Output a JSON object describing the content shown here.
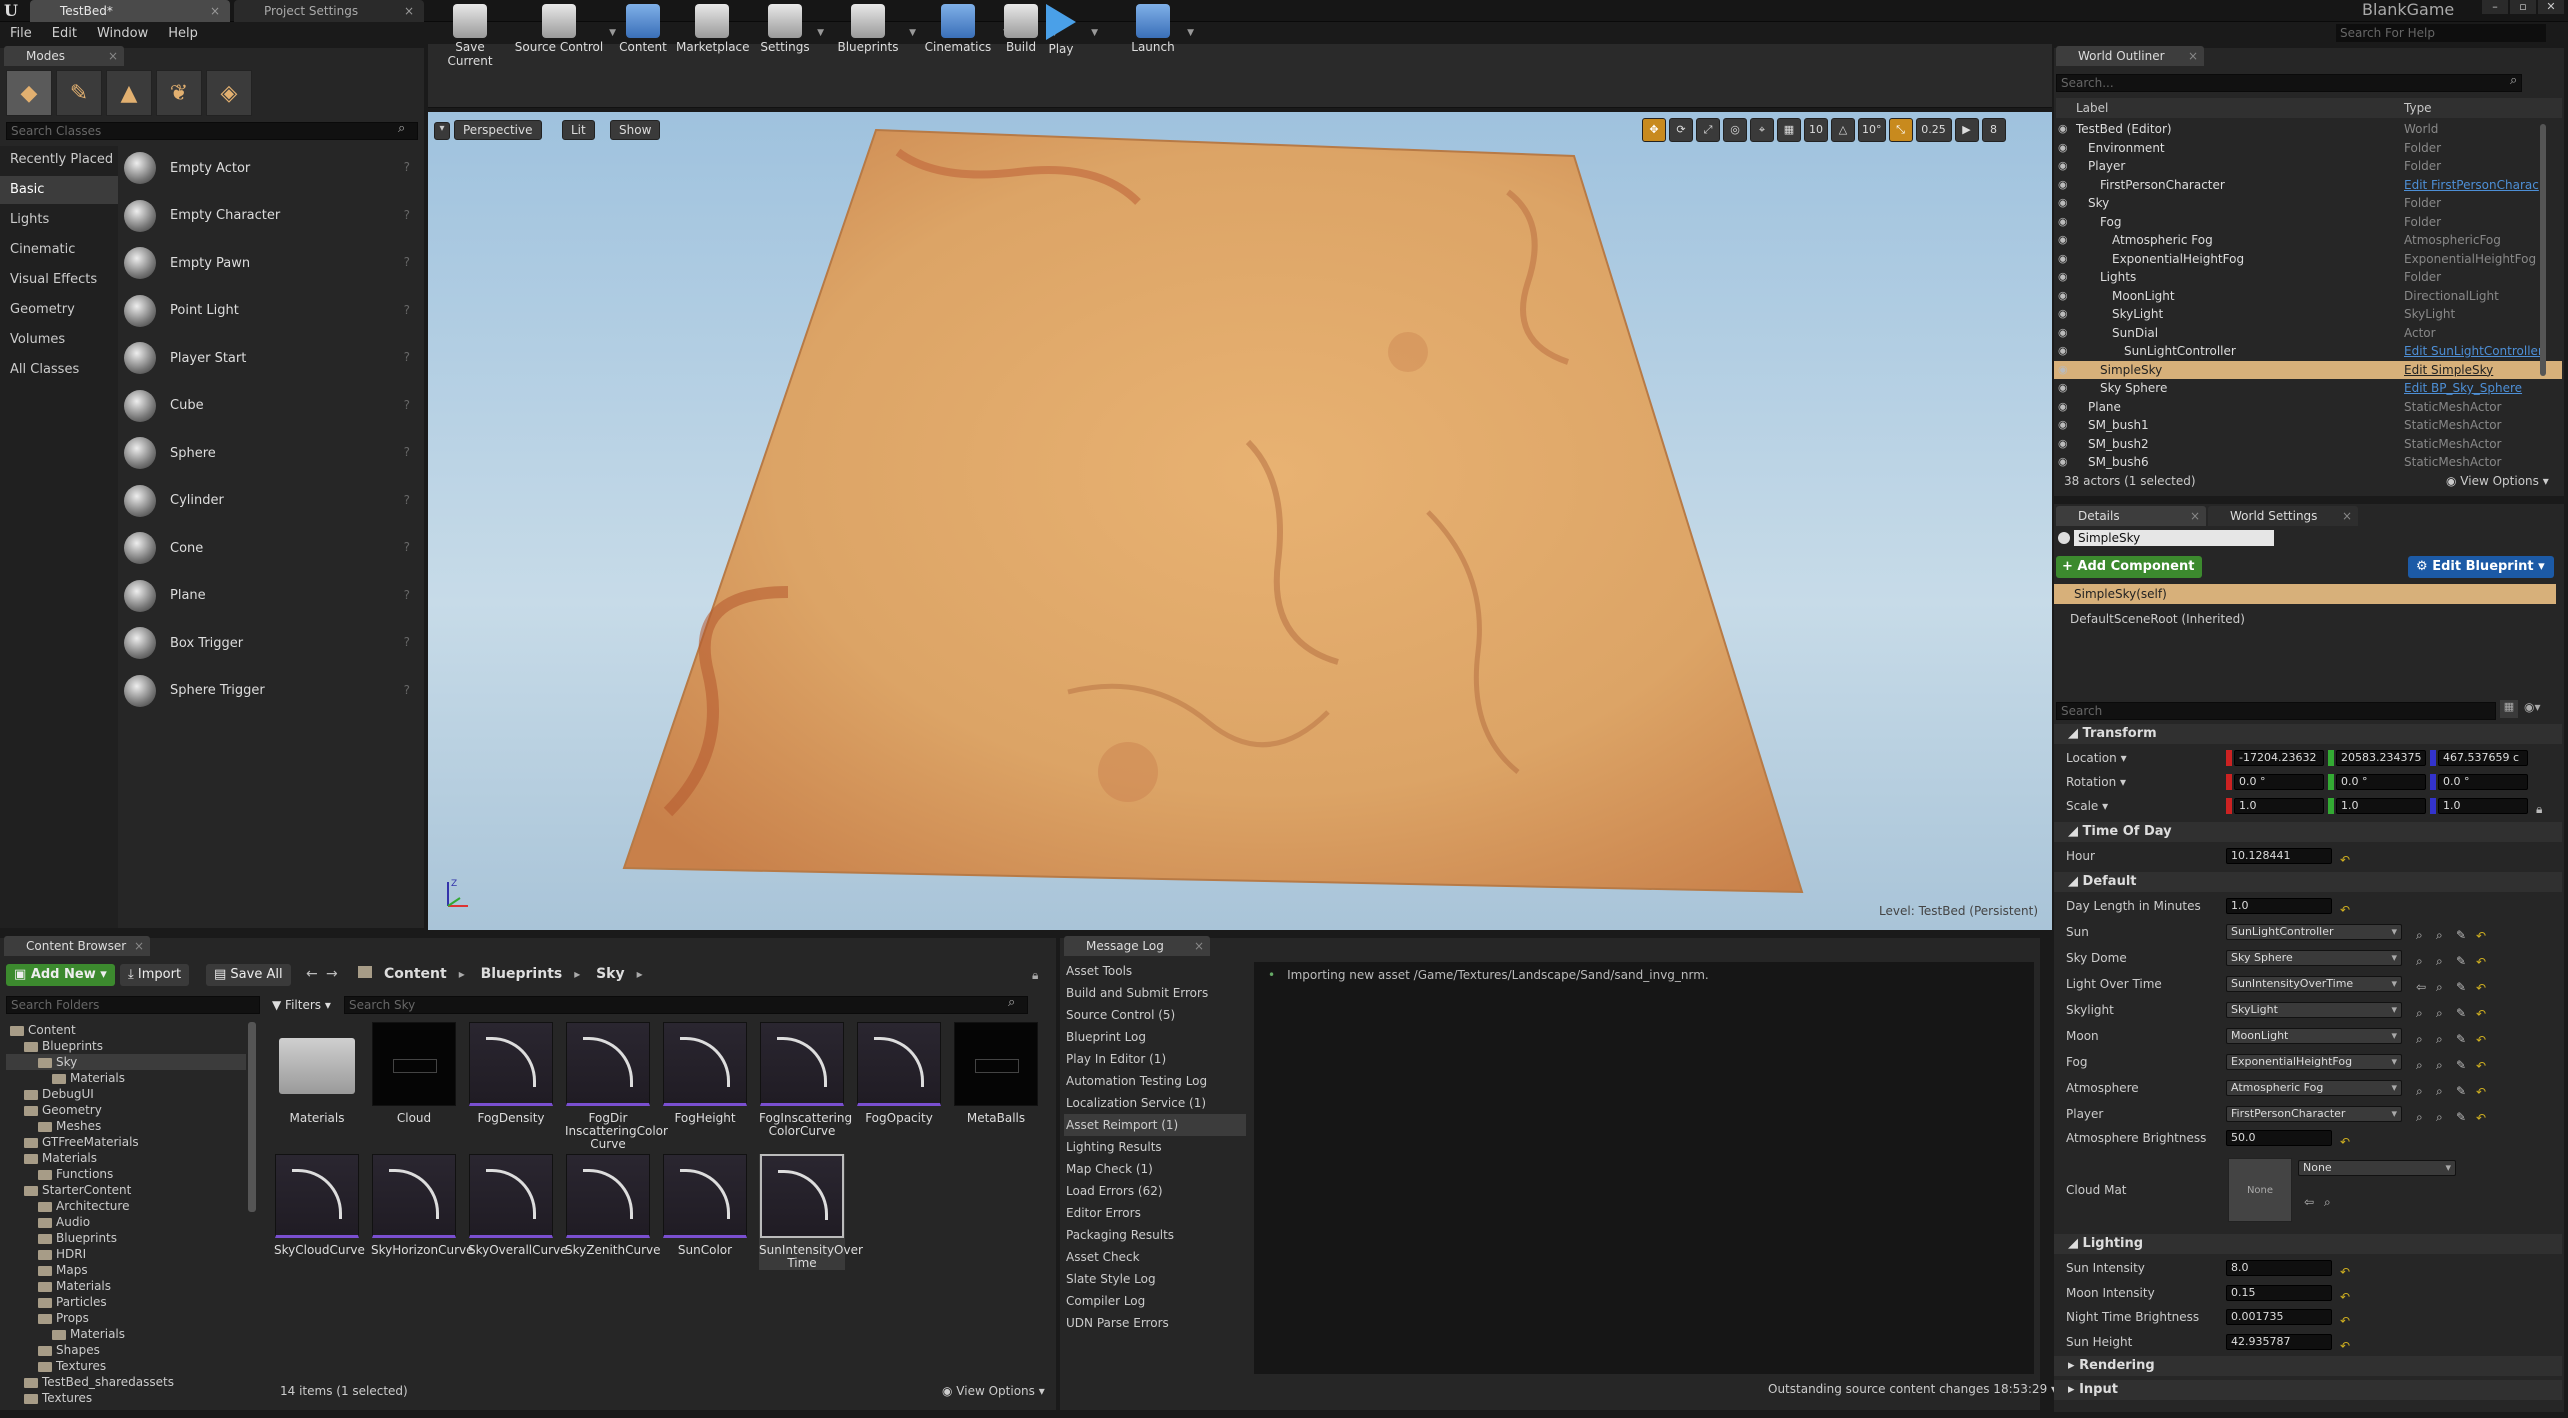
{
  "window": {
    "tabs": [
      "TestBed*",
      "Project Settings"
    ],
    "game_name": "BlankGame",
    "help_search_placeholder": "Search For Help",
    "menu": [
      "File",
      "Edit",
      "Window",
      "Help"
    ]
  },
  "modes": {
    "tab": "Modes",
    "search_placeholder": "Search Classes",
    "categories": [
      "Recently Placed",
      "Basic",
      "Lights",
      "Cinematic",
      "Visual Effects",
      "Geometry",
      "Volumes",
      "All Classes"
    ],
    "selected_category": "Basic",
    "items": [
      "Empty Actor",
      "Empty Character",
      "Empty Pawn",
      "Point Light",
      "Player Start",
      "Cube",
      "Sphere",
      "Cylinder",
      "Cone",
      "Plane",
      "Box Trigger",
      "Sphere Trigger"
    ]
  },
  "toolbar": {
    "buttons": [
      "Save Current",
      "Source Control",
      "Content",
      "Marketplace",
      "Settings",
      "Blueprints",
      "Cinematics",
      "Build",
      "Play",
      "Launch"
    ]
  },
  "viewport": {
    "perspective": "Perspective",
    "lit": "Lit",
    "show": "Show",
    "grid_snap": "10",
    "rot_snap": "10°",
    "scale_snap": "0.25",
    "cam_speed": "8",
    "level_prefix": "Level:",
    "level_name": "TestBed (Persistent)"
  },
  "content_browser": {
    "tab": "Content Browser",
    "add_new": "Add New",
    "import": "Import",
    "save_all": "Save All",
    "breadcrumb": [
      "Content",
      "Blueprints",
      "Sky"
    ],
    "folder_search_placeholder": "Search Folders",
    "filters": "Filters",
    "asset_search_placeholder": "Search Sky",
    "tree": [
      {
        "label": "Content",
        "depth": 0
      },
      {
        "label": "Blueprints",
        "depth": 1
      },
      {
        "label": "Sky",
        "depth": 2
      },
      {
        "label": "Materials",
        "depth": 3
      },
      {
        "label": "DebugUI",
        "depth": 1
      },
      {
        "label": "Geometry",
        "depth": 1
      },
      {
        "label": "Meshes",
        "depth": 2
      },
      {
        "label": "GTFreeMaterials",
        "depth": 1
      },
      {
        "label": "Materials",
        "depth": 1
      },
      {
        "label": "Functions",
        "depth": 2
      },
      {
        "label": "StarterContent",
        "depth": 1
      },
      {
        "label": "Architecture",
        "depth": 2
      },
      {
        "label": "Audio",
        "depth": 2
      },
      {
        "label": "Blueprints",
        "depth": 2
      },
      {
        "label": "HDRI",
        "depth": 2
      },
      {
        "label": "Maps",
        "depth": 2
      },
      {
        "label": "Materials",
        "depth": 2
      },
      {
        "label": "Particles",
        "depth": 2
      },
      {
        "label": "Props",
        "depth": 2
      },
      {
        "label": "Materials",
        "depth": 3
      },
      {
        "label": "Shapes",
        "depth": 2
      },
      {
        "label": "Textures",
        "depth": 2
      },
      {
        "label": "TestBed_sharedassets",
        "depth": 1
      },
      {
        "label": "Textures",
        "depth": 1
      }
    ],
    "assets": [
      {
        "name": "Materials",
        "kind": "folder"
      },
      {
        "name": "Cloud",
        "kind": "black"
      },
      {
        "name": "FogDensity",
        "kind": "curve"
      },
      {
        "name": "FogDir InscatteringColor Curve",
        "kind": "curve"
      },
      {
        "name": "FogHeight",
        "kind": "curve"
      },
      {
        "name": "FogInscattering ColorCurve",
        "kind": "curve"
      },
      {
        "name": "FogOpacity",
        "kind": "curve"
      },
      {
        "name": "MetaBalls",
        "kind": "black"
      },
      {
        "name": "SkyCloudCurve",
        "kind": "curve"
      },
      {
        "name": "SkyHorizonCurve",
        "kind": "curve"
      },
      {
        "name": "SkyOverallCurve",
        "kind": "curve"
      },
      {
        "name": "SkyZenithCurve",
        "kind": "curve"
      },
      {
        "name": "SunColor",
        "kind": "curve"
      },
      {
        "name": "SunIntensityOver Time",
        "kind": "curve",
        "selected": true
      }
    ],
    "status": "14 items (1 selected)",
    "view_options": "View Options"
  },
  "message_log": {
    "tab": "Message Log",
    "categories": [
      "Asset Tools",
      "Build and Submit Errors",
      "Source Control (5)",
      "Blueprint Log",
      "Play In Editor (1)",
      "Automation Testing Log",
      "Localization Service (1)",
      "Asset Reimport (1)",
      "Lighting Results",
      "Map Check (1)",
      "Load Errors (62)",
      "Editor Errors",
      "Packaging Results",
      "Asset Check",
      "Slate Style Log",
      "Compiler Log",
      "UDN Parse Errors"
    ],
    "selected": "Asset Reimport (1)",
    "message": "Importing new asset /Game/Textures/Landscape/Sand/sand_invg_nrm.",
    "footer": "Outstanding source content changes 18:53:29"
  },
  "outliner": {
    "tab": "World Outliner",
    "search_placeholder": "Search...",
    "col_label": "Label",
    "col_type": "Type",
    "rows": [
      {
        "label": "TestBed (Editor)",
        "type": "World",
        "depth": 0,
        "link": false
      },
      {
        "label": "Environment",
        "type": "Folder",
        "depth": 1,
        "link": false
      },
      {
        "label": "Player",
        "type": "Folder",
        "depth": 1,
        "link": false
      },
      {
        "label": "FirstPersonCharacter",
        "type": "Edit FirstPersonCharac",
        "depth": 2,
        "link": true
      },
      {
        "label": "Sky",
        "type": "Folder",
        "depth": 1,
        "link": false
      },
      {
        "label": "Fog",
        "type": "Folder",
        "depth": 2,
        "link": false
      },
      {
        "label": "Atmospheric Fog",
        "type": "AtmosphericFog",
        "depth": 3,
        "link": false
      },
      {
        "label": "ExponentialHeightFog",
        "type": "ExponentialHeightFog",
        "depth": 3,
        "link": false
      },
      {
        "label": "Lights",
        "type": "Folder",
        "depth": 2,
        "link": false
      },
      {
        "label": "MoonLight",
        "type": "DirectionalLight",
        "depth": 3,
        "link": false
      },
      {
        "label": "SkyLight",
        "type": "SkyLight",
        "depth": 3,
        "link": false
      },
      {
        "label": "SunDial",
        "type": "Actor",
        "depth": 3,
        "link": false
      },
      {
        "label": "SunLightController",
        "type": "Edit SunLightController",
        "depth": 4,
        "link": true
      },
      {
        "label": "SimpleSky",
        "type": "Edit SimpleSky",
        "depth": 2,
        "link": true,
        "selected": true
      },
      {
        "label": "Sky Sphere",
        "type": "Edit BP_Sky_Sphere",
        "depth": 2,
        "link": true
      },
      {
        "label": "Plane",
        "type": "StaticMeshActor",
        "depth": 1,
        "link": false
      },
      {
        "label": "SM_bush1",
        "type": "StaticMeshActor",
        "depth": 1,
        "link": false
      },
      {
        "label": "SM_bush2",
        "type": "StaticMeshActor",
        "depth": 1,
        "link": false
      },
      {
        "label": "SM_bush6",
        "type": "StaticMeshActor",
        "depth": 1,
        "link": false
      }
    ],
    "status": "38 actors (1 selected)",
    "view_options": "View Options"
  },
  "details": {
    "tab": "Details",
    "tab2": "World Settings",
    "name": "SimpleSky",
    "add_component": "+ Add Component",
    "edit_blueprint": "Edit Blueprint",
    "self_row": "SimpleSky(self)",
    "root_row": "DefaultSceneRoot (Inherited)",
    "search_placeholder": "Search",
    "transform": {
      "title": "Transform",
      "location_label": "Location",
      "location": [
        "-17204.23632",
        "20583.234375",
        "467.537659 c"
      ],
      "rotation_label": "Rotation",
      "rotation": [
        "0.0 °",
        "0.0 °",
        "0.0 °"
      ],
      "scale_label": "Scale",
      "scale": [
        "1.0",
        "1.0",
        "1.0"
      ]
    },
    "time_of_day": {
      "title": "Time Of Day",
      "hour_label": "Hour",
      "hour": "10.128441"
    },
    "default": {
      "title": "Default",
      "day_length_label": "Day Length in Minutes",
      "day_length": "1.0",
      "refs": [
        {
          "label": "Sun",
          "value": "SunLightController"
        },
        {
          "label": "Sky Dome",
          "value": "Sky Sphere"
        },
        {
          "label": "Light Over Time",
          "value": "SunIntensityOverTime"
        },
        {
          "label": "Skylight",
          "value": "SkyLight"
        },
        {
          "label": "Moon",
          "value": "MoonLight"
        },
        {
          "label": "Fog",
          "value": "ExponentialHeightFog"
        },
        {
          "label": "Atmosphere",
          "value": "Atmospheric Fog"
        },
        {
          "label": "Player",
          "value": "FirstPersonCharacter"
        }
      ],
      "atmo_bright_label": "Atmosphere Brightness",
      "atmo_bright": "50.0",
      "cloud_mat_label": "Cloud Mat",
      "cloud_mat_thumb": "None",
      "cloud_mat_value": "None"
    },
    "lighting": {
      "title": "Lighting",
      "rows": [
        {
          "label": "Sun Intensity",
          "value": "8.0"
        },
        {
          "label": "Moon Intensity",
          "value": "0.15"
        },
        {
          "label": "Night Time Brightness",
          "value": "0.001735"
        },
        {
          "label": "Sun Height",
          "value": "42.935787"
        }
      ]
    },
    "rendering": "Rendering",
    "input": "Input"
  },
  "colors": {
    "accent_orange": "#c88a1e",
    "add_new_green": "#3c8a2e",
    "edit_blueprint_blue": "#1c5aa6",
    "selection_tan": "#d7b07a",
    "link_blue": "#4d8fd6"
  }
}
